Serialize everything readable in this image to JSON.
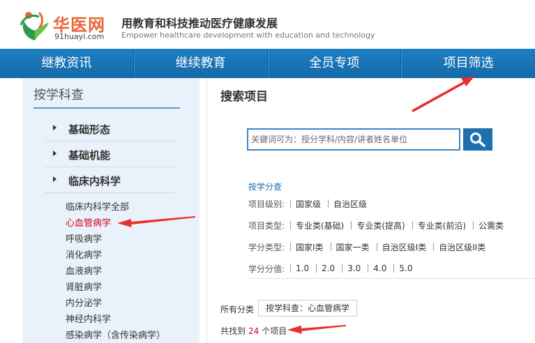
{
  "header": {
    "logo_name": "华医网",
    "logo_domain": "91huayi.com",
    "slogan_zh": "用教育和科技推动医疗健康发展",
    "slogan_en": "Empower healthcare development with education and technology"
  },
  "nav": [
    {
      "label": "继教资讯"
    },
    {
      "label": "继续教育"
    },
    {
      "label": "全员专项"
    },
    {
      "label": "项目筛选"
    }
  ],
  "sidebar": {
    "title": "按学科查",
    "categories": [
      {
        "label": "基础形态"
      },
      {
        "label": "基础机能"
      },
      {
        "label": "临床内科学"
      }
    ],
    "subitems": [
      {
        "label": "临床内科学全部",
        "active": false
      },
      {
        "label": "心血管病学",
        "active": true
      },
      {
        "label": "呼吸病学",
        "active": false
      },
      {
        "label": "消化病学",
        "active": false
      },
      {
        "label": "血液病学",
        "active": false
      },
      {
        "label": "肾脏病学",
        "active": false
      },
      {
        "label": "内分泌学",
        "active": false
      },
      {
        "label": "神经内科学",
        "active": false
      },
      {
        "label": "感染病学（含传染病学）",
        "active": false
      }
    ]
  },
  "main": {
    "title": "搜索项目",
    "search": {
      "placeholder": "关键词可为：授分学科/内容/讲者姓名单位",
      "value": ""
    },
    "filter_head": "按学分查",
    "filters": [
      {
        "label": "项目级别:",
        "options": [
          "国家级",
          "自治区级"
        ]
      },
      {
        "label": "项目类型:",
        "options": [
          "专业类(基础)",
          "专业类(提高)",
          "专业类(前沿)",
          "公需类"
        ]
      },
      {
        "label": "学分类型:",
        "options": [
          "国家I类",
          "国家一类",
          "自治区级I类",
          "自治区级II类"
        ]
      },
      {
        "label": "学分分值:",
        "options": [
          "1.0",
          "2.0",
          "3.0",
          "4.0",
          "5.0"
        ]
      }
    ],
    "crumb_label": "所有分类",
    "crumb_tag": "按学科查：心血管病学",
    "found_prefix": "共找到",
    "found_count": "24",
    "found_suffix": "个项目"
  },
  "colors": {
    "nav_bg": "#1874b8",
    "accent": "#1d6fb0",
    "highlight": "#d9001b",
    "annotation_arrow": "#e8302a",
    "sidebar_bg": "#e9f2fa"
  }
}
